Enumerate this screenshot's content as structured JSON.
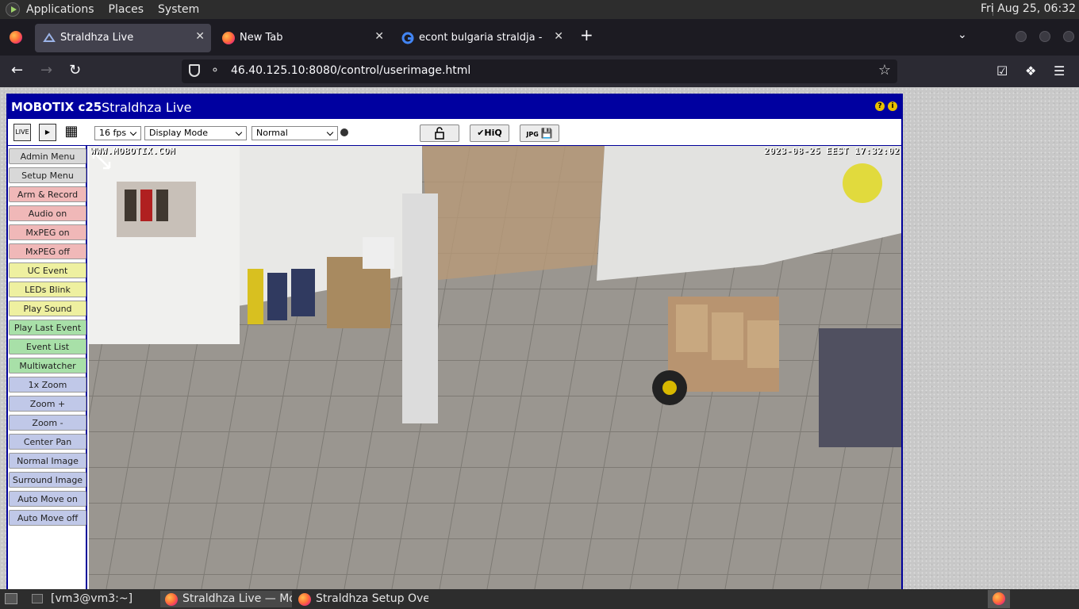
{
  "top_panel": {
    "menus": [
      "Applications",
      "Places",
      "System"
    ],
    "clock": "Fri Aug 25, 06:32"
  },
  "tabs": [
    {
      "label": "Straldhza Live",
      "icon": "camera-icon",
      "active": true
    },
    {
      "label": "New Tab",
      "icon": "firefox-icon",
      "active": false
    },
    {
      "label": "econt bulgaria straldja - Google",
      "icon": "google-icon",
      "active": false
    }
  ],
  "navbar": {
    "url": "46.40.125.10:8080/control/userimage.html"
  },
  "camera": {
    "brand": "MOBOTIX c25",
    "title": "Straldhza Live",
    "toolbar": {
      "modes": [
        "LIVE",
        "▶",
        "▦"
      ],
      "fps": "16 fps",
      "display_mode": "Display Mode",
      "quality": "Normal",
      "hiq_label": "✔HiQ",
      "jpg_label": "JPG"
    },
    "side_menu": [
      {
        "label": "Admin Menu",
        "color": "#d8d8d8"
      },
      {
        "label": "Setup Menu",
        "color": "#d8d8d8"
      },
      {
        "label": "Arm & Record",
        "color": "#f0b8b8"
      },
      {
        "label": "Audio on",
        "color": "#f0b8b8"
      },
      {
        "label": "MxPEG on",
        "color": "#f0b8b8"
      },
      {
        "label": "MxPEG off",
        "color": "#f0b8b8"
      },
      {
        "label": "UC Event",
        "color": "#eef0a0"
      },
      {
        "label": "LEDs Blink",
        "color": "#eef0a0"
      },
      {
        "label": "Play Sound",
        "color": "#eef0a0"
      },
      {
        "label": "Play Last Event",
        "color": "#a8e0a8"
      },
      {
        "label": "Event List",
        "color": "#a8e0a8"
      },
      {
        "label": "Multiwatcher",
        "color": "#a8e0a8"
      },
      {
        "label": "1x Zoom",
        "color": "#c0c8e8"
      },
      {
        "label": "Zoom +",
        "color": "#c0c8e8"
      },
      {
        "label": "Zoom -",
        "color": "#c0c8e8"
      },
      {
        "label": "Center Pan",
        "color": "#c0c8e8"
      },
      {
        "label": "Normal Image",
        "color": "#c0c8e8"
      },
      {
        "label": "Surround Image",
        "color": "#c0c8e8"
      },
      {
        "label": "Auto Move on",
        "color": "#c0c8e8"
      },
      {
        "label": "Auto Move off",
        "color": "#c0c8e8"
      }
    ],
    "osd_left": "WWW.MOBOTIX.COM",
    "osd_right": "2023-08-25 EEST 17:32:02"
  },
  "taskbar": {
    "items": [
      "[vm3@vm3:~]",
      "Straldhza Live — Mo...",
      "Straldhza Setup Ove..."
    ]
  }
}
